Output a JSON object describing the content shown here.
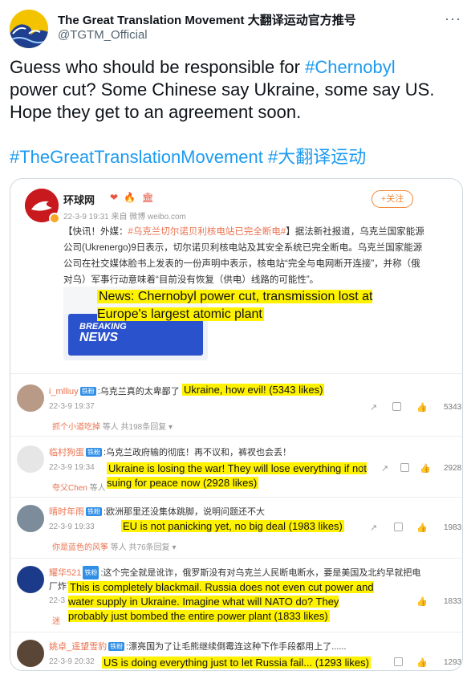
{
  "tweet": {
    "author_name": "The Great Translation Movement 大翻译运动官方推号",
    "author_handle": "@TGTM_Official",
    "text_line1_prefix": "Guess who should be responsible for ",
    "text_hashtag1": "#Chernobyl",
    "text_line2": "power cut? Some Chinese say Ukraine, some say US.",
    "text_line3": "Hope they get to an agreement soon.",
    "hashtag2": "#TheGreatTranslationMovement",
    "hashtag3": "#大翻译运动"
  },
  "weibo_post": {
    "name": "环球网",
    "emoji": "❤ 🔥 🏛",
    "meta": "22-3-9 19:31 来自 微博 weibo.com",
    "follow_label": "+关注",
    "body_prefix": "【快讯！外媒：",
    "body_tag": "#乌克兰切尔诺贝利核电站已完全断电#",
    "body_rest": "】据法新社报道，乌克兰国家能源公司(Ukrenergo)9日表示，切尔诺贝利核电站及其安全系统已完全断电。乌克兰国家能源公司在社交媒体脸书上发表的一份声明中表示，核电站“完全与电网断开连接”，并称（俄对乌）军事行动意味着“目前没有恢复（供电）线路的可能性”。",
    "thumb_line1": "BREAKING",
    "thumb_line2": "NEWS",
    "translation": "News: Chernobyl power cut, transmission lost at Europe's largest atomic plant"
  },
  "comments": [
    {
      "user": "i_mlliuy",
      "badge": "铁粉",
      "text": ":乌克兰真的太卑鄙了",
      "date": "22-3-9 19:37",
      "reply_link": "抓个小道吃掉",
      "reply_rest": " 等人 共198条回复 ▾",
      "likes": "5343",
      "translation": "Ukraine, how evil! (5343 likes)"
    },
    {
      "user": "临村狗蛋",
      "badge": "铁粉",
      "text": ":乌克兰政府输的彻底！再不议和，裤衩也会丢！",
      "date": "22-3-9 19:34",
      "reply_link": "夸父Chen",
      "reply_rest": " 等人",
      "likes": "2928",
      "translation": "Ukraine is losing the war! They will lose everything if not suing for peace now (2928 likes)"
    },
    {
      "user": "晴时年雨",
      "badge": "铁粉",
      "text": ":欧洲那里还没集体跳脚，说明问题还不大",
      "date": "22-3-9 19:33",
      "reply_link": "你是蓝色的风筝",
      "reply_rest": " 等人 共76条回复 ▾",
      "likes": "1983",
      "translation": "EU is not panicking yet, no big deal (1983 likes)"
    },
    {
      "user": "耀华521",
      "badge": "铁粉",
      "text": ":这个完全就是讹诈，俄罗斯没有对乌克兰人民断电断水，要是美国及北约早就把电厂炸了。",
      "date": "22-3",
      "reply_link": "迷",
      "reply_rest": "",
      "likes": "1833",
      "translation": "This is completely blackmail. Russia does not even cut power and water supply in Ukraine. Imagine what will NATO do? They probably just bombed the entire power plant (1833 likes)"
    },
    {
      "user": "姚卓_遥望雪豹",
      "badge": "铁粉",
      "text": ":漂亮国为了让毛熊继续倒霉连这种下作手段都用上了......",
      "date": "22-3-9 20:32",
      "reply_link": "",
      "reply_rest": "",
      "likes": "1293",
      "translation": "US is doing everything just to let Russia fail... (1293 likes)"
    }
  ]
}
